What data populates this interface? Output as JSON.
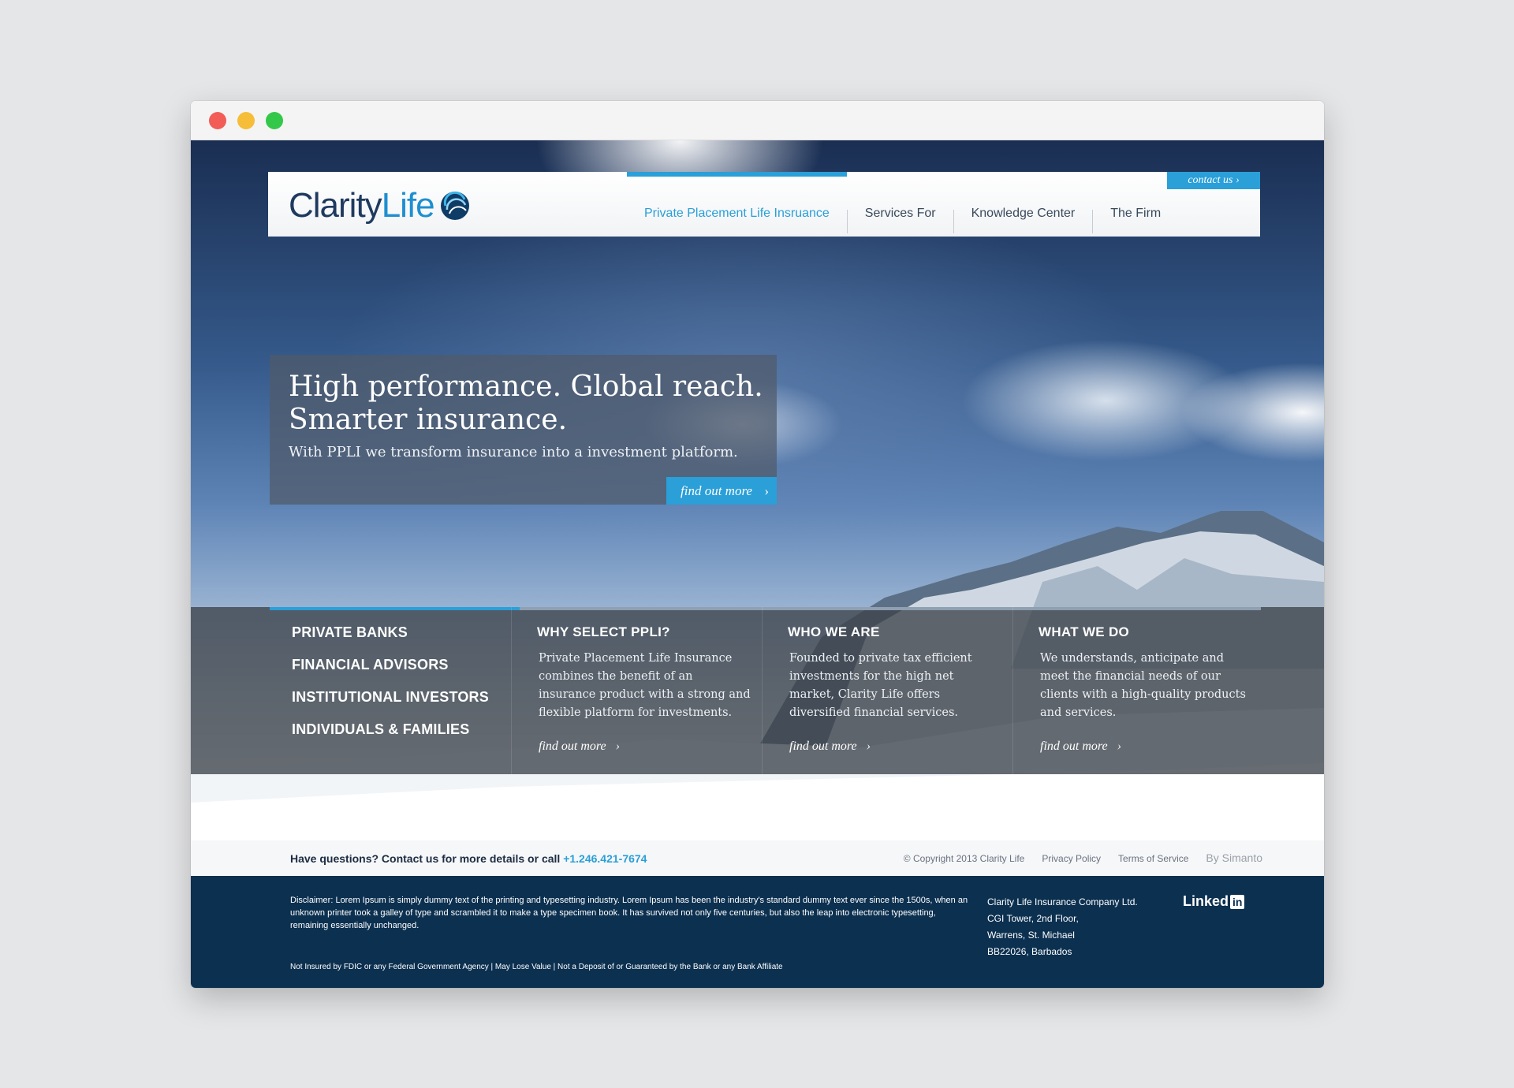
{
  "header": {
    "logo_part1": "Clarity",
    "logo_part2": "Life",
    "nav": [
      {
        "label": "Private Placement Life Insruance"
      },
      {
        "label": "Services For"
      },
      {
        "label": "Knowledge Center"
      },
      {
        "label": "The Firm"
      }
    ],
    "contact_label": "contact us",
    "chevron": "›"
  },
  "hero": {
    "title_line1": "High performance. Global reach.",
    "title_line2": "Smarter insurance.",
    "subtitle": "With PPLI we transform insurance into a investment platform.",
    "button_label": "find out more"
  },
  "audiences": [
    "PRIVATE BANKS",
    "FINANCIAL ADVISORS",
    "INSTITUTIONAL INVESTORS",
    "INDIVIDUALS & FAMILIES"
  ],
  "columns": [
    {
      "heading": "WHY SELECT PPLI?",
      "body": "Private Placement Life Insurance combines the benefit of an insurance product with a strong and flexible platform for investments.",
      "link": "find out more"
    },
    {
      "heading": "WHO WE ARE",
      "body": "Founded to private tax efficient investments for the high net market, Clarity Life offers diversified financial services.",
      "link": "find out more"
    },
    {
      "heading": "WHAT WE DO",
      "body": "We understands, anticipate and meet the financial needs of our clients with a high-quality products and services.",
      "link": "find out more"
    }
  ],
  "contact_strip": {
    "question": "Have questions? Contact us for more details or call ",
    "phone": "+1.246.421-7674",
    "copyright": "© Copyright 2013 Clarity Life",
    "privacy": "Privacy Policy",
    "terms": "Terms of Service",
    "by": "By Simanto"
  },
  "footer": {
    "disclaimer": "Disclaimer: Lorem Ipsum is simply dummy text of the printing and typesetting industry. Lorem Ipsum has been the industry's standard dummy text ever since the 1500s, when an unknown printer took a galley of type and scrambled it to make a type specimen book. It has survived not only five centuries, but also the leap into electronic typesetting, remaining essentially unchanged.",
    "notes": "Not Insured by FDIC or any Federal Government Agency  |  May Lose Value  |  Not a Deposit of or Guaranteed by the Bank or any Bank Affiliate",
    "address": [
      "Clarity Life Insurance Company Ltd.",
      "CGI Tower, 2nd Floor,",
      "Warrens, St. Michael",
      "BB22026, Barbados"
    ],
    "linkedin_text": "Linked",
    "linkedin_in": "in"
  },
  "colors": {
    "accent": "#2a9fd8",
    "navy": "#0c3050",
    "text_dark": "#1c2c42"
  }
}
